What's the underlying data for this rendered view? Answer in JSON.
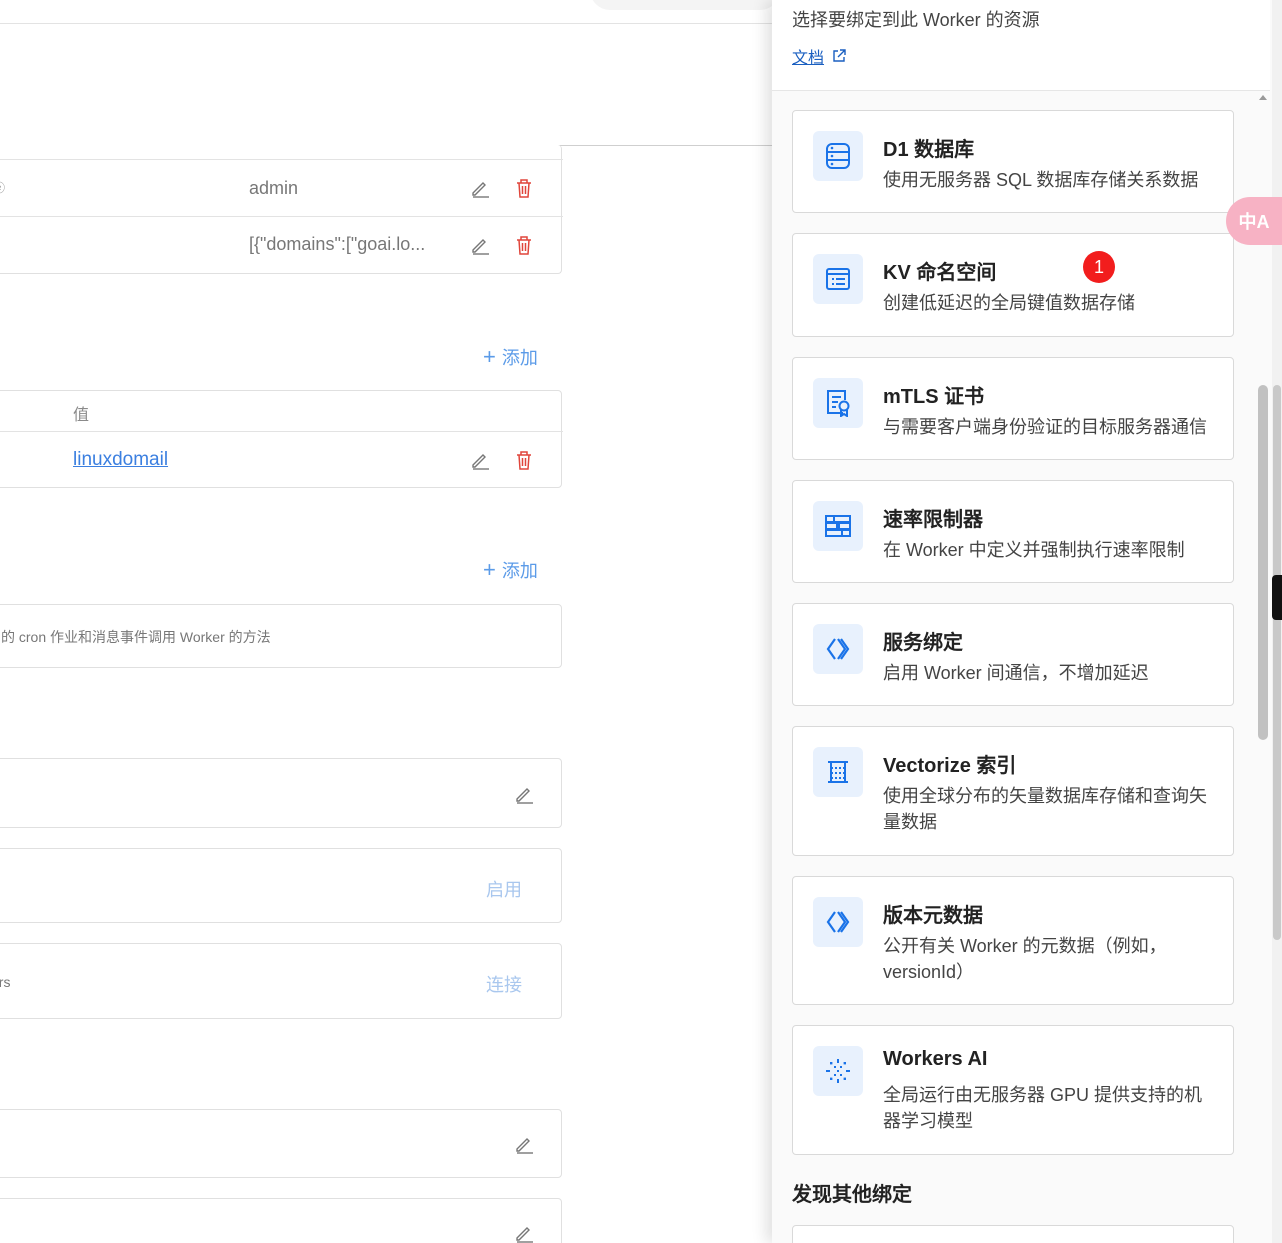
{
  "left": {
    "env_rows": [
      {
        "name": "ⓔ",
        "value": "admin"
      },
      {
        "name": "",
        "value": "[{\"domains\":[\"goai.lo..."
      }
    ],
    "add_label_1": "添加",
    "kv_table": {
      "header_value": "值",
      "row_value": "linuxdomail"
    },
    "add_label_2": "添加",
    "trigger_desc": "的 cron 作业和消息事件调用 Worker 的方法",
    "enable_label": "启用",
    "connect_prefix": "ers",
    "connect_label": "连接"
  },
  "drawer": {
    "subtitle": "选择要绑定到此 Worker 的资源",
    "docs_link": "文档",
    "bindings": [
      {
        "icon": "database-icon",
        "title": "D1 数据库",
        "desc": "使用无服务器 SQL 数据库存储关系数据"
      },
      {
        "icon": "kv-list-icon",
        "title": "KV 命名空间",
        "desc": "创建低延迟的全局键值数据存储"
      },
      {
        "icon": "certificate-icon",
        "title": "mTLS 证书",
        "desc": "与需要客户端身份验证的目标服务器通信"
      },
      {
        "icon": "rate-limiter-icon",
        "title": "速率限制器",
        "desc": "在 Worker 中定义并强制执行速率限制"
      },
      {
        "icon": "service-binding-icon",
        "title": "服务绑定",
        "desc": "启用 Worker 间通信，不增加延迟"
      },
      {
        "icon": "vectorize-icon",
        "title": "Vectorize 索引",
        "desc": "使用全球分布的矢量数据库存储和查询矢量数据"
      },
      {
        "icon": "version-metadata-icon",
        "title": "版本元数据",
        "desc": "公开有关 Worker 的元数据（例如，versionId）"
      },
      {
        "icon": "workers-ai-icon",
        "title": "Workers AI",
        "desc": "全局运行由无服务器 GPU 提供支持的机器学习模型"
      }
    ],
    "badge_count": "1",
    "discover_heading": "发现其他绑定"
  },
  "translate_widget": {
    "label": "中A"
  },
  "colors": {
    "accent": "#1a73e8",
    "danger": "#e0453b",
    "badge": "#f21d1d"
  }
}
